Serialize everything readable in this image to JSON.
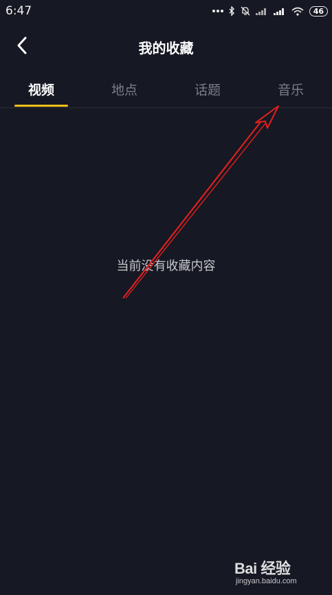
{
  "status_bar": {
    "time": "6:47",
    "battery": "46",
    "icons": [
      "more-dots-icon",
      "bluetooth-icon",
      "mute-icon",
      "signal-icon",
      "signal-icon",
      "wifi-icon",
      "battery-icon"
    ]
  },
  "header": {
    "title": "我的收藏",
    "back_icon": "chevron-left-icon"
  },
  "tabs": [
    {
      "label": "视频",
      "active": true
    },
    {
      "label": "地点",
      "active": false
    },
    {
      "label": "话题",
      "active": false
    },
    {
      "label": "音乐",
      "active": false
    }
  ],
  "accent_color": "#f8c11a",
  "annotation_color": "#e0201f",
  "empty_state": {
    "message": "当前没有收藏内容"
  },
  "watermark": {
    "logo": "Bai 经验",
    "sub": "jingyan.baidu.com"
  }
}
